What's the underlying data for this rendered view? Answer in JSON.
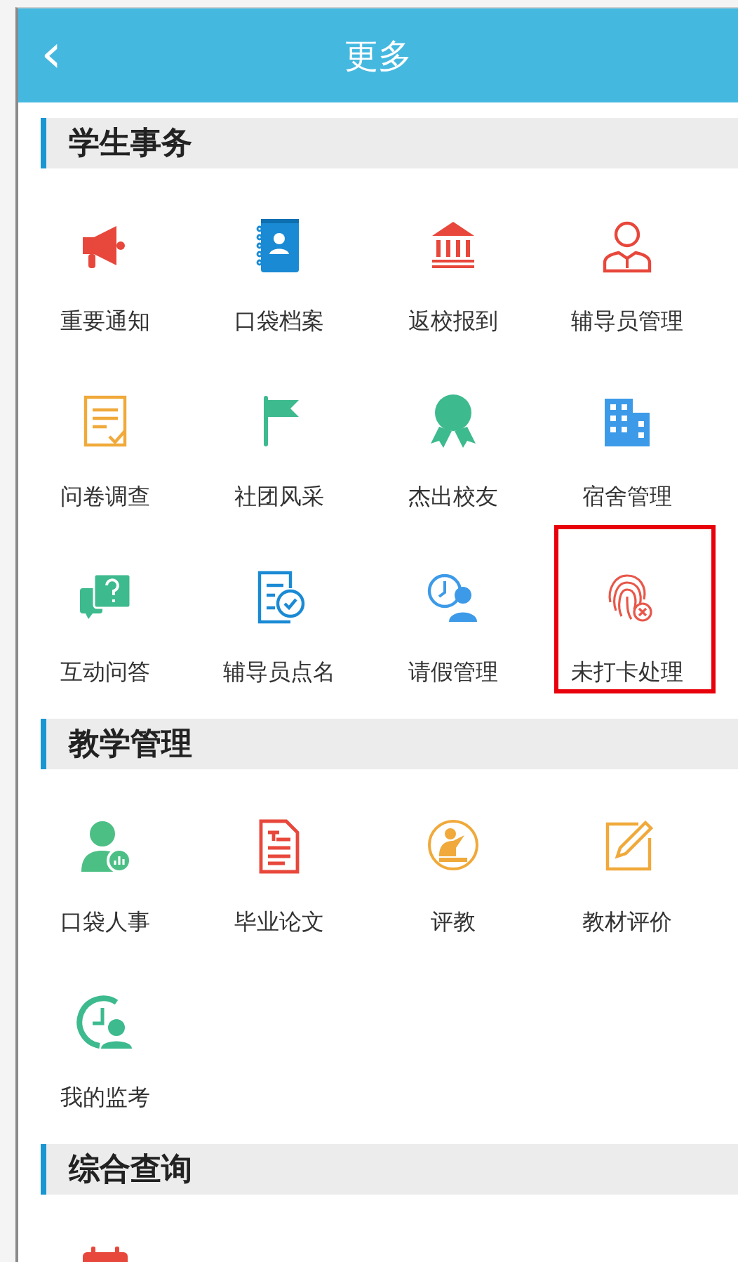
{
  "header": {
    "back": "‹",
    "title": "更多"
  },
  "sections": [
    {
      "title": "学生事务",
      "items": [
        {
          "kind": "megaphone",
          "label": "重要通知",
          "highlighted": false
        },
        {
          "kind": "contact-book",
          "label": "口袋档案",
          "highlighted": false
        },
        {
          "kind": "bank",
          "label": "返校报到",
          "highlighted": false
        },
        {
          "kind": "person-tie",
          "label": "辅导员管理",
          "highlighted": false
        },
        {
          "kind": "checklist",
          "label": "问卷调查",
          "highlighted": false
        },
        {
          "kind": "flag",
          "label": "社团风采",
          "highlighted": false
        },
        {
          "kind": "award",
          "label": "杰出校友",
          "highlighted": false
        },
        {
          "kind": "building",
          "label": "宿舍管理",
          "highlighted": false
        },
        {
          "kind": "question-chat",
          "label": "互动问答",
          "highlighted": false
        },
        {
          "kind": "document-check",
          "label": "辅导员点名",
          "highlighted": false
        },
        {
          "kind": "clock-person",
          "label": "请假管理",
          "highlighted": false
        },
        {
          "kind": "fingerprint",
          "label": "未打卡处理",
          "highlighted": true
        }
      ]
    },
    {
      "title": "教学管理",
      "items": [
        {
          "kind": "person-chart",
          "label": "口袋人事",
          "highlighted": false
        },
        {
          "kind": "document",
          "label": "毕业论文",
          "highlighted": false
        },
        {
          "kind": "teacher",
          "label": "评教",
          "highlighted": false
        },
        {
          "kind": "pencil-edit",
          "label": "教材评价",
          "highlighted": false
        },
        {
          "kind": "clock-user",
          "label": "我的监考",
          "highlighted": false
        }
      ]
    },
    {
      "title": "综合查询",
      "items": [
        {
          "kind": "calendar",
          "highlighted": false
        }
      ]
    }
  ]
}
